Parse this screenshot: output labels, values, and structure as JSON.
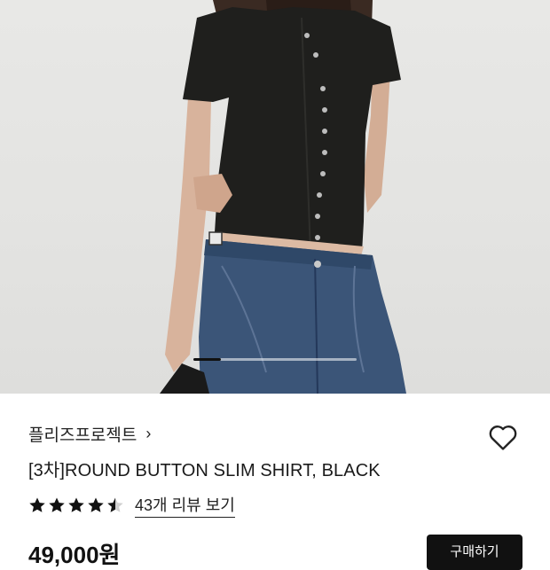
{
  "product": {
    "image_alt": "model wearing black round button slim shirt",
    "carousel_progress": 0.17,
    "brand": "플리즈프로젝트",
    "brand_chevron": "›",
    "title": "[3차]ROUND BUTTON SLIM SHIRT, BLACK",
    "rating_stars": 4.5,
    "review_link": "43개 리뷰 보기",
    "price": "49,000원",
    "buy_label": "구매하기"
  },
  "icons": {
    "wishlist": "heart-outline-icon",
    "brand_arrow": "chevron-right-icon",
    "star": "star-icon"
  },
  "colors": {
    "accent": "#111111",
    "background": "#ffffff",
    "star": "#111111"
  }
}
